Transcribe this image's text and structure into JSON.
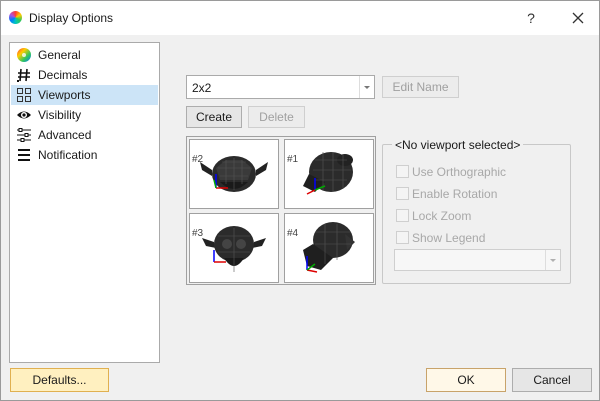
{
  "window": {
    "title": "Display Options",
    "help": "?"
  },
  "sidebar": {
    "items": [
      {
        "label": "General",
        "icon": "color-wheel-icon"
      },
      {
        "label": "Decimals",
        "icon": "hash-icon"
      },
      {
        "label": "Viewports",
        "icon": "grid-icon",
        "selected": true
      },
      {
        "label": "Visibility",
        "icon": "eye-icon"
      },
      {
        "label": "Advanced",
        "icon": "sliders-icon"
      },
      {
        "label": "Notification",
        "icon": "list-icon"
      }
    ]
  },
  "viewports": {
    "layout_value": "2x2",
    "edit_name_label": "Edit Name",
    "create_label": "Create",
    "delete_label": "Delete",
    "cells": [
      {
        "label": "#2"
      },
      {
        "label": "#1"
      },
      {
        "label": "#3"
      },
      {
        "label": "#4"
      }
    ],
    "group_title": "<No viewport selected>",
    "options": [
      {
        "label": "Use Orthographic"
      },
      {
        "label": "Enable Rotation"
      },
      {
        "label": "Lock Zoom"
      },
      {
        "label": "Show Legend"
      }
    ],
    "select_value": ""
  },
  "footer": {
    "defaults_label": "Defaults...",
    "ok_label": "OK",
    "cancel_label": "Cancel"
  },
  "colors": {
    "accent_selection": "#cce4f7",
    "primary_border": "#c8a36a",
    "defaults_bg": "#fff0c0"
  }
}
